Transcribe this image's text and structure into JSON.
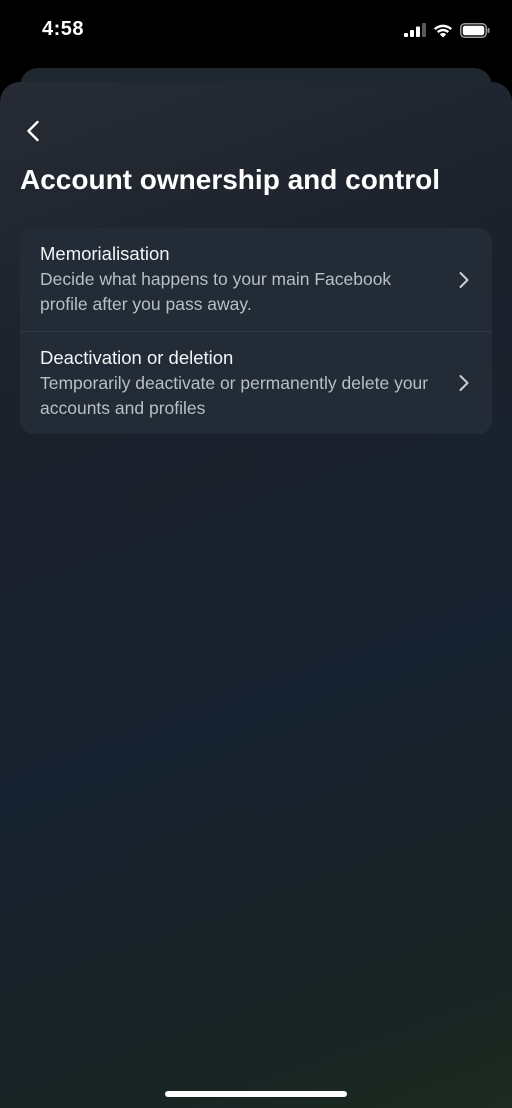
{
  "status_bar": {
    "time": "4:58",
    "icons": [
      "cellular-signal-icon",
      "wifi-icon",
      "battery-icon"
    ]
  },
  "header": {
    "back_icon": "chevron-left-icon",
    "title": "Account ownership and control"
  },
  "menu": {
    "items": [
      {
        "title": "Memorialisation",
        "description": "Decide what happens to your main Facebook profile after you pass away.",
        "icon": "chevron-right-icon"
      },
      {
        "title": "Deactivation or deletion",
        "description": "Temporarily deactivate or permanently delete your accounts and profiles",
        "icon": "chevron-right-icon"
      }
    ]
  },
  "colors": {
    "card_background": "#222b36",
    "title_text": "#ffffff",
    "secondary_text": "#b7bfc8"
  }
}
